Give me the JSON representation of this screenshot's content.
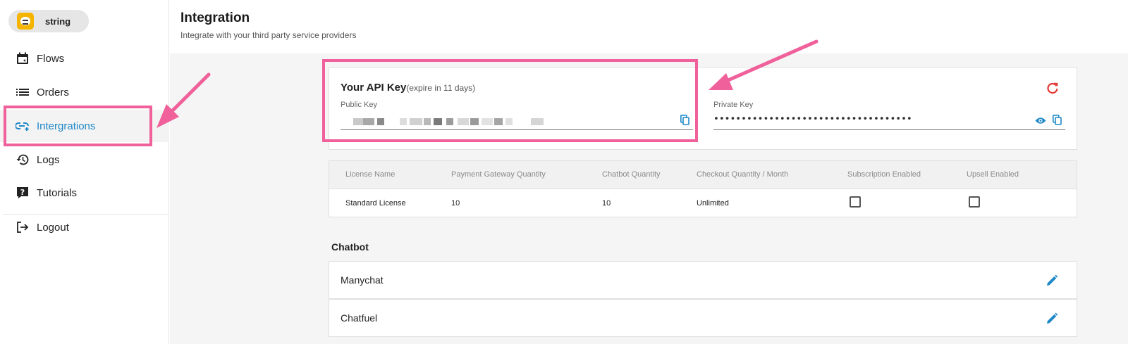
{
  "workspace": {
    "name": "string"
  },
  "sidebar": {
    "items": [
      {
        "label": "Flows",
        "icon": "calendar-icon"
      },
      {
        "label": "Orders",
        "icon": "list-icon"
      },
      {
        "label": "Intergrations",
        "icon": "integration-icon",
        "active": true
      },
      {
        "label": "Logs",
        "icon": "history-icon"
      },
      {
        "label": "Tutorials",
        "icon": "help-icon"
      }
    ],
    "logout_label": "Logout"
  },
  "header": {
    "title": "Integration",
    "subtitle": "Integrate with your third party service providers"
  },
  "api_key": {
    "title": "Your API Key",
    "expire_note": "(expire in 11 days)",
    "public_label": "Public Key",
    "private_label": "Private Key",
    "private_value": "••••••••••••••••••••••••••••••••••••"
  },
  "license_table": {
    "headers": [
      "License Name",
      "Payment Gateway Quantity",
      "Chatbot Quantity",
      "Checkout Quantity / Month",
      "Subscription Enabled",
      "Upsell Enabled"
    ],
    "row": [
      "Standard License",
      "10",
      "10",
      "Unlimited"
    ],
    "subscription_enabled": false,
    "upsell_enabled": false
  },
  "chatbot": {
    "title": "Chatbot",
    "items": [
      "Manychat",
      "Chatfuel"
    ]
  },
  "colors": {
    "accent": "#1e88c7",
    "highlight": "#f0609a",
    "refresh": "#e53935"
  }
}
